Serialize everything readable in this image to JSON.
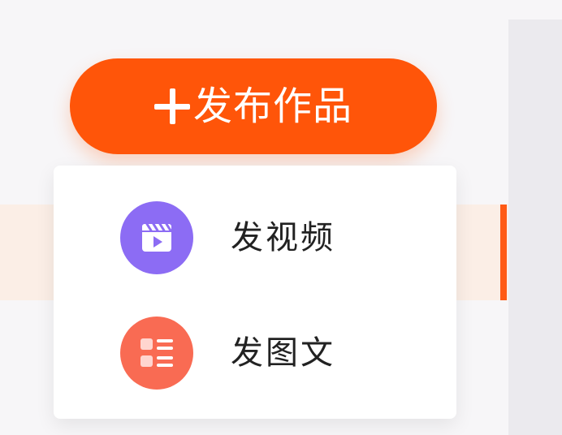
{
  "colors": {
    "accent": "#ff5509",
    "highlight": "#fbeee6",
    "video_icon": "#8c6cf4",
    "article_icon": "#f96b53"
  },
  "publish_button": {
    "icon": "plus-icon",
    "label": "发布作品"
  },
  "menu": {
    "items": [
      {
        "icon": "video-clapper-icon",
        "label": "发视频"
      },
      {
        "icon": "image-text-list-icon",
        "label": "发图文"
      }
    ]
  }
}
